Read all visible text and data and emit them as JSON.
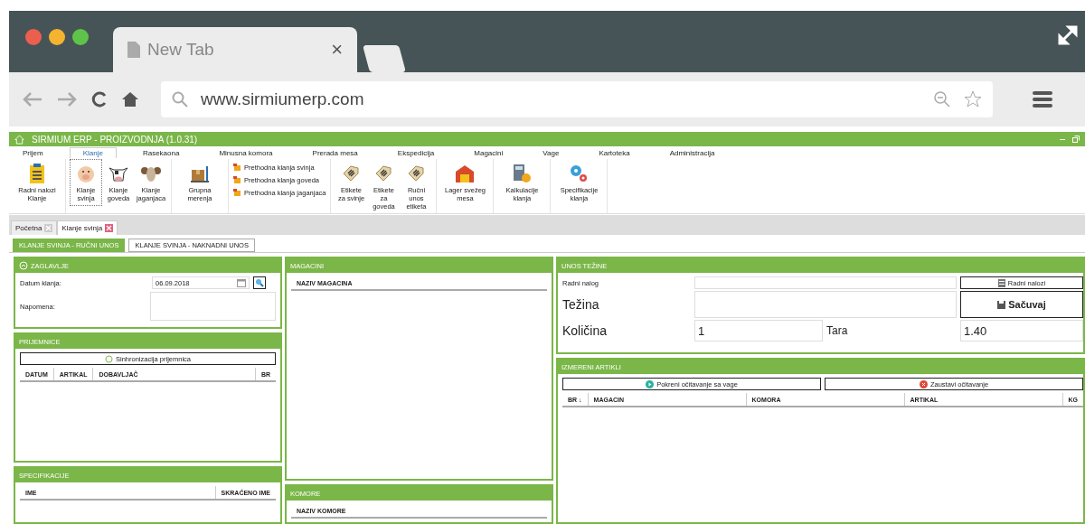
{
  "browser": {
    "tab_title": "New Tab",
    "tab_close": "×",
    "url": "www.sirmiumerp.com"
  },
  "app": {
    "title": "SIRMIUM ERP - PROIZVODNJA (1.0.31)"
  },
  "menu_tabs": [
    {
      "label": "Prijem",
      "selected": false
    },
    {
      "label": "Klanje",
      "selected": true
    },
    {
      "label": "Rasekaona",
      "selected": false
    },
    {
      "label": "Minusna komora",
      "selected": false
    },
    {
      "label": "Prerada mesa",
      "selected": false
    },
    {
      "label": "Ekspedicija",
      "selected": false
    },
    {
      "label": "Magacini",
      "selected": false
    },
    {
      "label": "Vage",
      "selected": false
    },
    {
      "label": "Kartoteka",
      "selected": false
    },
    {
      "label": "Administracija",
      "selected": false
    }
  ],
  "ribbon_groups": [
    {
      "kind": "large",
      "items": [
        {
          "label": "Radni nalozi Klanje",
          "selected": false
        }
      ]
    },
    {
      "kind": "large",
      "items": [
        {
          "label": "Klanje svinja",
          "selected": true
        },
        {
          "label": "Klanje goveda",
          "selected": false
        },
        {
          "label": "Klanje jaganjaca",
          "selected": false
        }
      ]
    },
    {
      "kind": "large",
      "items": [
        {
          "label": "Grupna merenja",
          "selected": false
        }
      ]
    },
    {
      "kind": "list",
      "items": [
        {
          "label": "Prethodna klanja svinja",
          "selected": false
        },
        {
          "label": "Prethodna klanja goveda",
          "selected": false
        },
        {
          "label": "Prethodna klanja jaganjaca",
          "selected": false
        }
      ]
    },
    {
      "kind": "large",
      "items": [
        {
          "label": "Etikete za svinje",
          "selected": false
        },
        {
          "label": "Etikete za goveda",
          "selected": false
        },
        {
          "label": "Ručni unos etiketa",
          "selected": false
        }
      ]
    },
    {
      "kind": "large",
      "items": [
        {
          "label": "Lager svežeg mesa",
          "selected": false
        }
      ]
    },
    {
      "kind": "large",
      "items": [
        {
          "label": "Kalkulacije klanja",
          "selected": false
        }
      ]
    },
    {
      "kind": "large",
      "items": [
        {
          "label": "Specifikacije klanja",
          "selected": false
        }
      ]
    }
  ],
  "doc_tabs": [
    {
      "label": "Početna",
      "selected": false
    },
    {
      "label": "Klanje svinja",
      "selected": true
    }
  ],
  "sub_tabs": [
    {
      "label": "KLANJE SVINJA - RUČNI UNOS",
      "selected": true
    },
    {
      "label": "KLANJE SVINJA - NAKNADNI UNOS",
      "selected": false
    }
  ],
  "zaglavlje": {
    "title": "ZAGLAVLJE",
    "date_label": "Datum klanja:",
    "date_value": "06.09.2018",
    "note_label": "Napomena:"
  },
  "prijemnice": {
    "title": "PRIJEMNICE",
    "sync_button": "Sinhronizacija prijemnica",
    "columns": [
      "DATUM",
      "ARTIKAL",
      "DOBAVLJAČ",
      "BR"
    ]
  },
  "specifikacije": {
    "title": "SPECIFIKACIJE",
    "columns": [
      "IME",
      "SKRAĆENO IME"
    ]
  },
  "magacini": {
    "title": "MAGACINI",
    "columns": [
      "NAZIV MAGACINA"
    ]
  },
  "komore": {
    "title": "KOMORE",
    "columns": [
      "NAZIV KOMORE"
    ]
  },
  "unos_tezine": {
    "title": "UNOS TEŽINE",
    "order_label": "Radni nalog",
    "orders_button": "Radni nalozi",
    "weight_label": "Težina",
    "save_button": "Sačuvaj",
    "qty_label": "Količina",
    "qty_value": "1",
    "tara_label": "Tara",
    "tara_value": "1.40"
  },
  "izmereni": {
    "title": "IZMERENI ARTIKLI",
    "start_button": "Pokreni očitavanje sa vage",
    "stop_button": "Zaustavi očitavanje",
    "columns": [
      "BR ↓",
      "MAGACIN",
      "KOMORA",
      "ARTIKAL",
      "KG"
    ]
  }
}
